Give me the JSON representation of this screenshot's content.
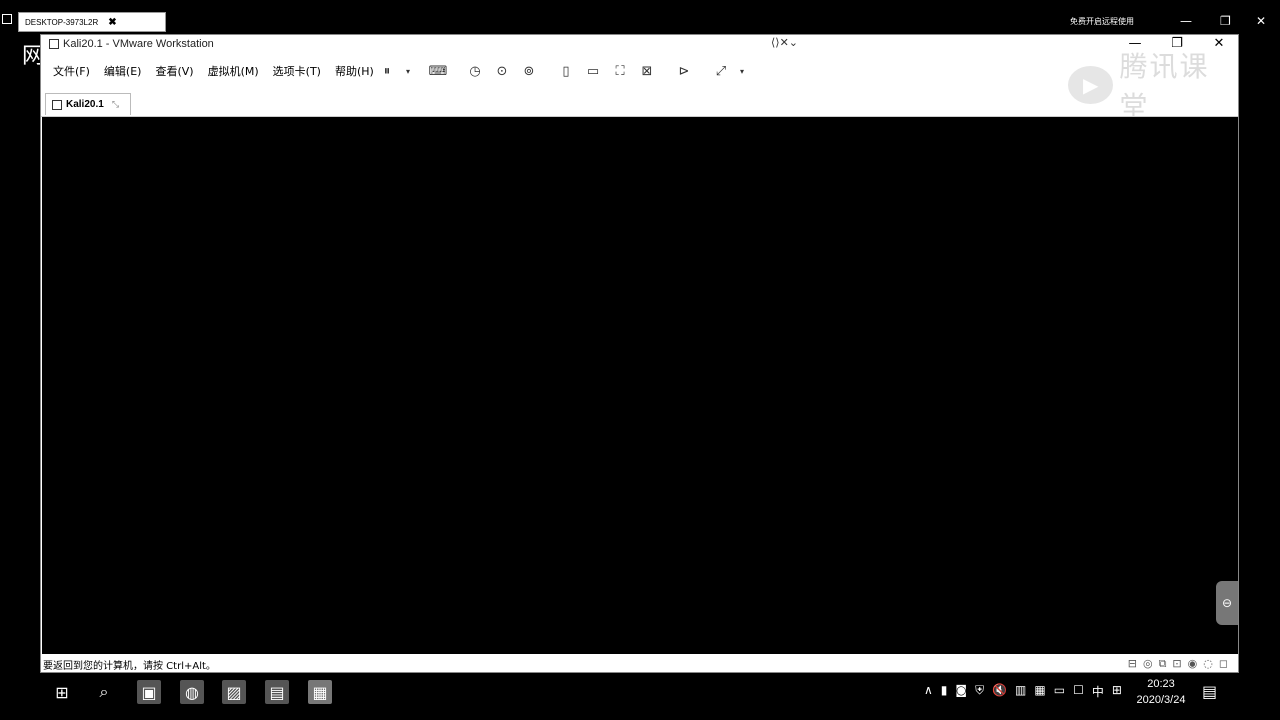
{
  "remote_session": {
    "tab_label": "DESKTOP-3973L2R",
    "close_glyph": "✖",
    "new_tab_glyph": "✚",
    "right_text": "免费开启远程使用"
  },
  "left_glyph": "网",
  "window": {
    "title": "Kali20.1 - VMware Workstation",
    "title_hint": "⟨⟩✕⌄",
    "minimize": "—",
    "maximize": "❐",
    "close": "✕"
  },
  "menu": {
    "items": [
      "文件(F)",
      "编辑(E)",
      "查看(V)",
      "虚拟机(M)",
      "选项卡(T)",
      "帮助(H)"
    ]
  },
  "toolbar": {
    "icons": {
      "pause": "⏸",
      "pause_dd": "▾",
      "send_keys": "⌨",
      "snapshot": "◷",
      "revert": "⊙",
      "snapshot_mgr": "⊚",
      "view_sidebar": "▯",
      "view_thumb": "▭",
      "fullscreen": "⛶",
      "unity": "⊠",
      "console": "⊳",
      "stretch": "⤢",
      "stretch_dd": "▾"
    }
  },
  "watermark": {
    "text": "腾讯课堂",
    "logo": "▶"
  },
  "vm_tab": {
    "label": "Kali20.1",
    "close": "⤡"
  },
  "side_handle": "⊖",
  "status": {
    "text": "要返回到您的计算机，请按 Ctrl+Alt。",
    "icons": [
      "⊟",
      "◎",
      "⧉",
      "⊡",
      "◉",
      "◌",
      "◻"
    ]
  },
  "taskbar": {
    "start": "⊞",
    "search": "⌕",
    "apps": [
      "▣",
      "◍",
      "▨",
      "▤",
      "▦"
    ],
    "tray": [
      "∧",
      "▮",
      "◙",
      "⛨",
      "🔇",
      "▥",
      "▦",
      "▭",
      "☐",
      "中",
      "⊞"
    ],
    "time": "20:23",
    "date": "2020/3/24",
    "notification": "▤"
  }
}
